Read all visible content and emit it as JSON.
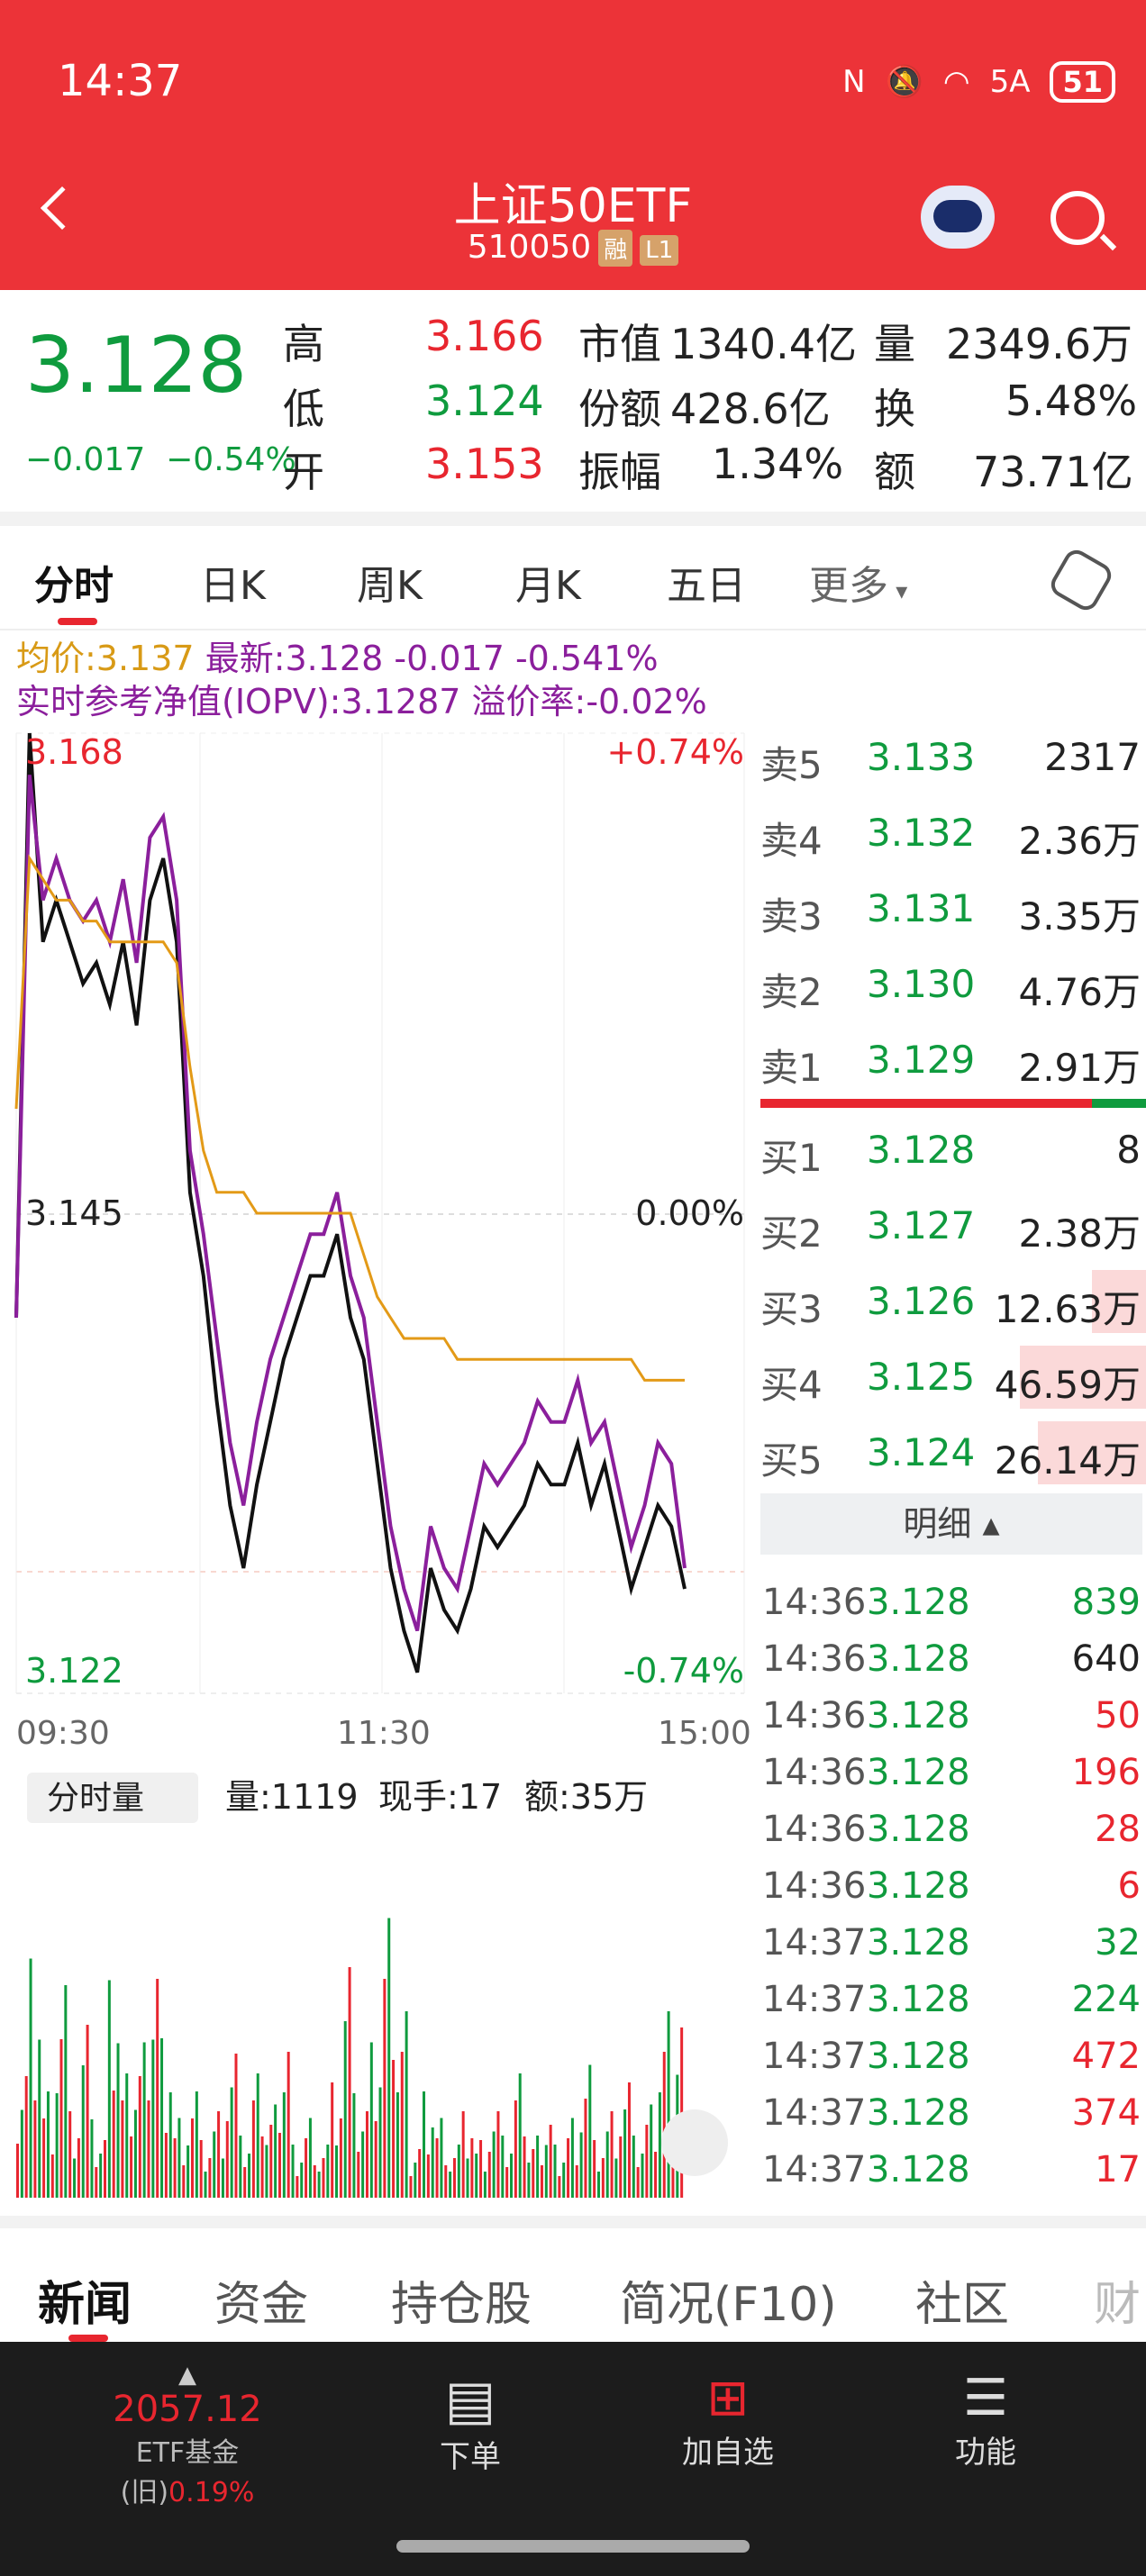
{
  "status": {
    "time": "14:37",
    "battery": "51",
    "network": "5A"
  },
  "header": {
    "title": "上证50ETF",
    "code": "510050",
    "tag1": "融",
    "tag2": "L1"
  },
  "quote": {
    "price": "3.128",
    "change": "−0.017",
    "change_pct": "−0.54%",
    "high_label": "高",
    "high": "3.166",
    "low_label": "低",
    "low": "3.124",
    "open_label": "开",
    "open": "3.153",
    "mktcap_label": "市值",
    "mktcap": "1340.4亿",
    "shares_label": "份额",
    "shares": "428.6亿",
    "amp_label": "振幅",
    "amp": "1.34%",
    "vol_label": "量",
    "vol": "2349.6万",
    "turn_label": "换",
    "turn": "5.48%",
    "amt_label": "额",
    "amt": "73.71亿"
  },
  "tabs": [
    "分时",
    "日K",
    "周K",
    "月K",
    "五日",
    "更多"
  ],
  "chart_info": {
    "avg": "均价:3.137",
    "last": "最新:3.128",
    "chg": "-0.017",
    "pct": "-0.541%",
    "iopv": "实时参考净值(IOPV):3.1287",
    "premium": "溢价率:-0.02%"
  },
  "chart_data": {
    "type": "line",
    "ylim": [
      3.122,
      3.168
    ],
    "y_top": "3.168",
    "y_mid": "3.145",
    "y_bot": "3.122",
    "pct_top": "+0.74%",
    "pct_mid": "0.00%",
    "pct_bot": "-0.74%",
    "xticks": [
      "09:30",
      "11:30",
      "15:00"
    ],
    "series": [
      {
        "color": "#111",
        "values": [
          3.14,
          3.168,
          3.158,
          3.16,
          3.158,
          3.156,
          3.157,
          3.155,
          3.158,
          3.154,
          3.16,
          3.162,
          3.158,
          3.146,
          3.142,
          3.136,
          3.131,
          3.128,
          3.132,
          3.135,
          3.138,
          3.14,
          3.142,
          3.142,
          3.144,
          3.14,
          3.138,
          3.133,
          3.128,
          3.125,
          3.123,
          3.128,
          3.126,
          3.125,
          3.127,
          3.13,
          3.129,
          3.13,
          3.131,
          3.133,
          3.132,
          3.132,
          3.134,
          3.131,
          3.133,
          3.13,
          3.127,
          3.129,
          3.131,
          3.13,
          3.127
        ]
      },
      {
        "color": "#8b1f9c",
        "values": [
          3.14,
          3.166,
          3.16,
          3.162,
          3.16,
          3.159,
          3.16,
          3.158,
          3.161,
          3.157,
          3.163,
          3.164,
          3.16,
          3.148,
          3.144,
          3.139,
          3.134,
          3.131,
          3.135,
          3.138,
          3.14,
          3.142,
          3.144,
          3.144,
          3.146,
          3.142,
          3.14,
          3.135,
          3.13,
          3.127,
          3.125,
          3.13,
          3.128,
          3.127,
          3.13,
          3.133,
          3.132,
          3.133,
          3.134,
          3.136,
          3.135,
          3.135,
          3.137,
          3.134,
          3.135,
          3.132,
          3.129,
          3.131,
          3.134,
          3.133,
          3.128
        ]
      },
      {
        "color": "#e39a17",
        "values": [
          3.15,
          3.162,
          3.161,
          3.16,
          3.16,
          3.159,
          3.159,
          3.158,
          3.158,
          3.158,
          3.158,
          3.158,
          3.157,
          3.152,
          3.148,
          3.146,
          3.146,
          3.146,
          3.145,
          3.145,
          3.145,
          3.145,
          3.145,
          3.145,
          3.145,
          3.145,
          3.143,
          3.141,
          3.14,
          3.139,
          3.139,
          3.139,
          3.139,
          3.138,
          3.138,
          3.138,
          3.138,
          3.138,
          3.138,
          3.138,
          3.138,
          3.138,
          3.138,
          3.138,
          3.138,
          3.138,
          3.138,
          3.137,
          3.137,
          3.137,
          3.137
        ]
      }
    ],
    "volume": [
      0.5,
      0.9,
      0.4,
      0.8,
      0.3,
      0.6,
      0.2,
      0.7,
      0.4,
      0.5,
      0.9,
      0.6,
      0.3,
      0.4,
      0.2,
      0.3,
      0.5,
      0.2,
      0.4,
      0.3,
      0.6,
      0.2,
      0.3,
      0.2,
      0.4,
      0.8,
      0.3,
      0.5,
      0.9,
      0.6,
      0.2,
      0.4,
      0.3,
      0.2,
      0.3,
      0.2,
      0.3,
      0.2,
      0.4,
      0.2,
      0.3,
      0.2,
      0.3,
      0.5,
      0.2,
      0.3,
      0.4,
      0.2,
      0.3,
      0.6,
      0.7
    ]
  },
  "volume_info": {
    "label": "分时量",
    "vol": "量:1119",
    "hand": "现手:17",
    "amt": "额:35万"
  },
  "orderbook": {
    "sell": [
      {
        "l": "卖5",
        "p": "3.133",
        "v": "2317"
      },
      {
        "l": "卖4",
        "p": "3.132",
        "v": "2.36万"
      },
      {
        "l": "卖3",
        "p": "3.131",
        "v": "3.35万"
      },
      {
        "l": "卖2",
        "p": "3.130",
        "v": "4.76万"
      },
      {
        "l": "卖1",
        "p": "3.129",
        "v": "2.91万"
      }
    ],
    "buy": [
      {
        "l": "买1",
        "p": "3.128",
        "v": "8"
      },
      {
        "l": "买2",
        "p": "3.127",
        "v": "2.38万"
      },
      {
        "l": "买3",
        "p": "3.126",
        "v": "12.63万"
      },
      {
        "l": "买4",
        "p": "3.125",
        "v": "46.59万"
      },
      {
        "l": "买5",
        "p": "3.124",
        "v": "26.14万"
      }
    ],
    "detail_label": "明细"
  },
  "ticks": [
    {
      "t": "14:36",
      "p": "3.128",
      "v": "839",
      "c": "green"
    },
    {
      "t": "14:36",
      "p": "3.128",
      "v": "640",
      "c": "black"
    },
    {
      "t": "14:36",
      "p": "3.128",
      "v": "50",
      "c": "red"
    },
    {
      "t": "14:36",
      "p": "3.128",
      "v": "196",
      "c": "red"
    },
    {
      "t": "14:36",
      "p": "3.128",
      "v": "28",
      "c": "red"
    },
    {
      "t": "14:36",
      "p": "3.128",
      "v": "6",
      "c": "red"
    },
    {
      "t": "14:37",
      "p": "3.128",
      "v": "32",
      "c": "green"
    },
    {
      "t": "14:37",
      "p": "3.128",
      "v": "224",
      "c": "green"
    },
    {
      "t": "14:37",
      "p": "3.128",
      "v": "472",
      "c": "red"
    },
    {
      "t": "14:37",
      "p": "3.128",
      "v": "374",
      "c": "red"
    },
    {
      "t": "14:37",
      "p": "3.128",
      "v": "17",
      "c": "red"
    }
  ],
  "bottom_tabs": [
    "新闻",
    "资金",
    "持仓股",
    "简况(F10)",
    "社区",
    "财"
  ],
  "nav": {
    "index_value": "2057.12",
    "index_name": "ETF基金(旧)",
    "index_pct": "0.19%",
    "order": "下单",
    "add": "加自选",
    "func": "功能"
  }
}
